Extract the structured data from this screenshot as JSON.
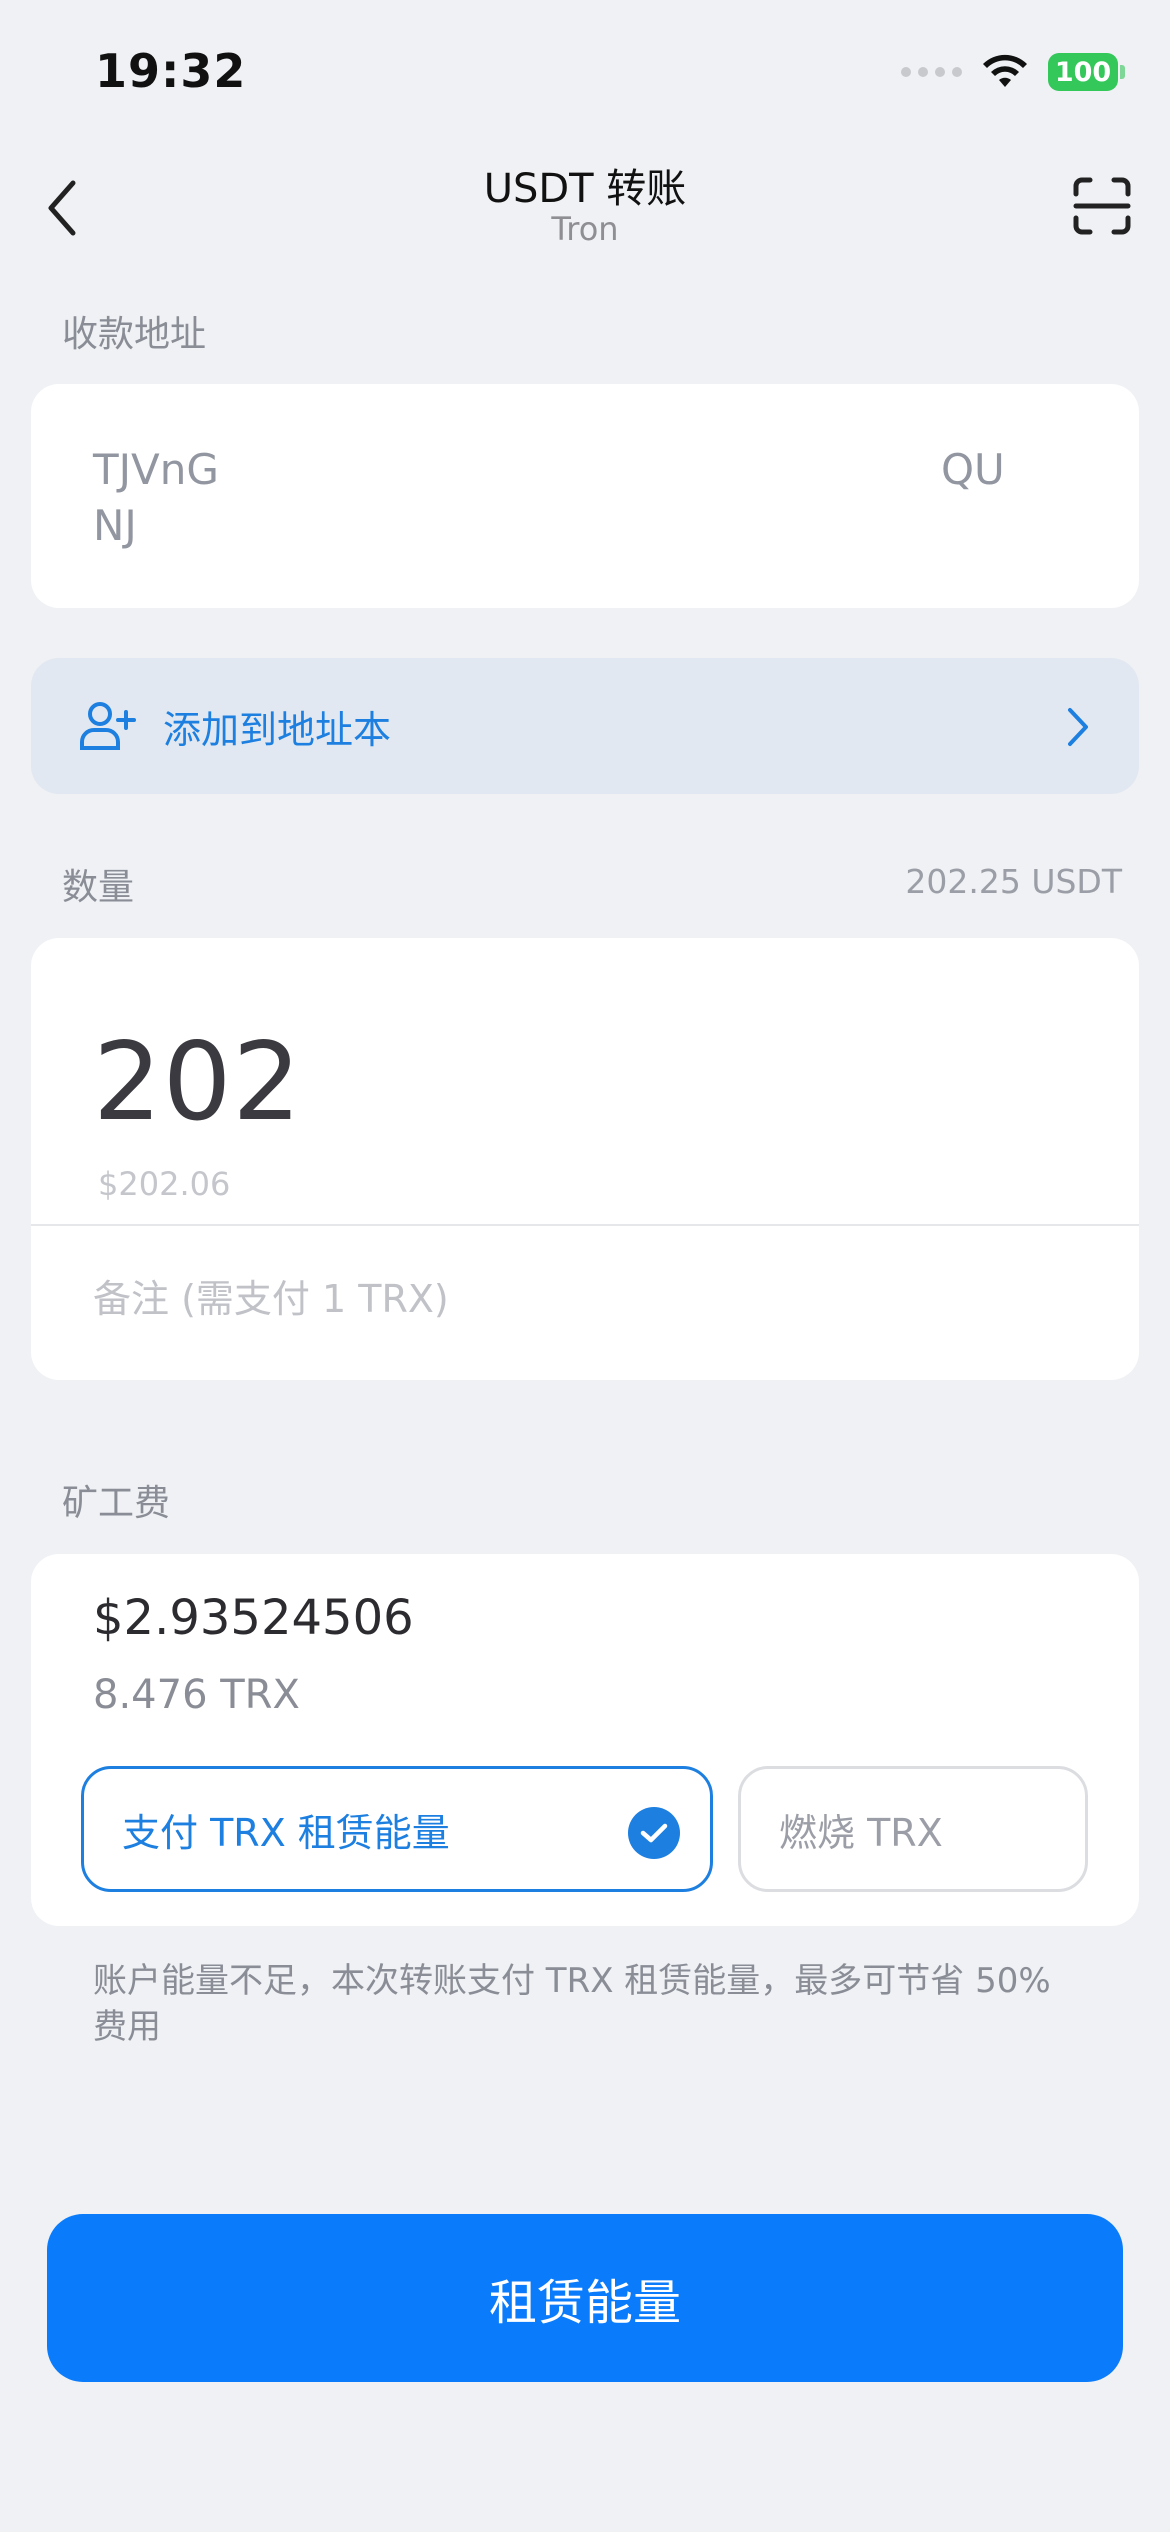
{
  "status_bar": {
    "time": "19:32",
    "battery": "100"
  },
  "nav": {
    "title": "USDT 转账",
    "subtitle": "Tron"
  },
  "recipient": {
    "label": "收款地址",
    "address_line1_start": "TJVnG",
    "address_line1_end": "QU",
    "address_line2": "NJ"
  },
  "address_book": {
    "label": "添加到地址本"
  },
  "amount": {
    "label": "数量",
    "balance": "202.25 USDT",
    "value": "202",
    "fiat": "$202.06",
    "memo_placeholder": "备注 (需支付 1 TRX)"
  },
  "fee": {
    "label": "矿工费",
    "usd": "$2.93524506",
    "trx": "8.476 TRX",
    "option_rent": "支付 TRX 租赁能量",
    "option_burn": "燃烧 TRX",
    "selected": "option_rent",
    "note": "账户能量不足，本次转账支付 TRX 租赁能量，最多可节省 50% 费用"
  },
  "submit_button": "租赁能量",
  "colors": {
    "accent": "#1d7fe0",
    "primary_button": "#0a7bfa",
    "battery": "#34c759"
  },
  "icons": [
    "back-chevron",
    "scan-icon",
    "add-user-icon",
    "chevron-right",
    "check-icon",
    "wifi-icon"
  ]
}
